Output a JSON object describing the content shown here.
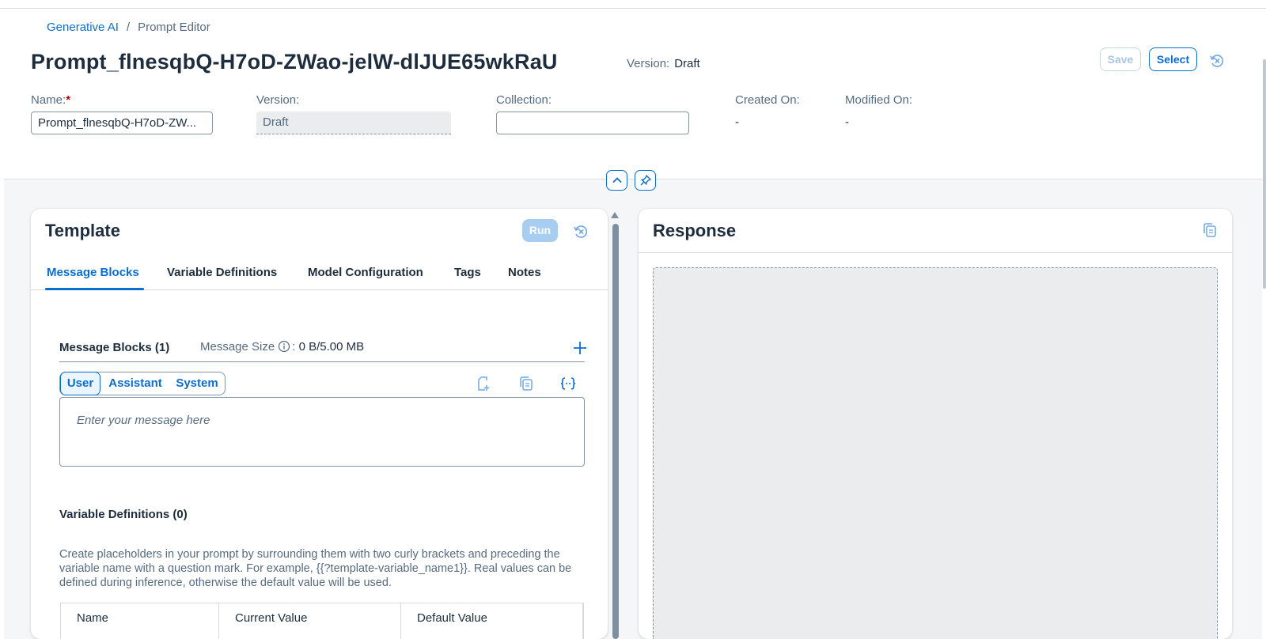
{
  "breadcrumb": {
    "parent": "Generative AI",
    "separator": "/",
    "current": "Prompt Editor"
  },
  "header": {
    "title": "Prompt_flnesqbQ-H7oD-ZWao-jelW-dlJUE65wkRaU",
    "version_label": "Version:",
    "version_value": "Draft",
    "save_label": "Save",
    "select_label": "Select"
  },
  "fields": {
    "name_label": "Name:",
    "name_required": "*",
    "name_value": "Prompt_flnesqbQ-H7oD-ZW...",
    "version_label": "Version:",
    "version_value": "Draft",
    "collection_label": "Collection:",
    "collection_value": "",
    "created_label": "Created On:",
    "created_value": "-",
    "modified_label": "Modified On:",
    "modified_value": "-"
  },
  "template": {
    "title": "Template",
    "run_label": "Run",
    "tabs": [
      "Message Blocks",
      "Variable Definitions",
      "Model Configuration",
      "Tags",
      "Notes"
    ],
    "active_tab": "Message Blocks",
    "message_blocks_title": "Message Blocks (1)",
    "message_size_label": "Message Size",
    "message_size_sep": ":",
    "message_size_value": "0 B/5.00 MB",
    "roles": [
      "User",
      "Assistant",
      "System"
    ],
    "selected_role": "User",
    "message_placeholder": "Enter your message here",
    "variable_definitions_title": "Variable Definitions (0)",
    "variable_definitions_desc": "Create placeholders in your prompt by surrounding them with two curly brackets and preceding the variable name with a question mark. For example, {{?template-variable_name1}}. Real values can be defined during inference, otherwise the default value will be used.",
    "table_headers": [
      "Name",
      "Current Value",
      "Default Value"
    ]
  },
  "response": {
    "title": "Response"
  },
  "colors": {
    "accent": "#0a6ed1",
    "text": "#1d2d3e",
    "muted": "#556b82",
    "required": "#aa0808"
  },
  "icons": [
    "cancel-icon",
    "chevron-up-icon",
    "pin-icon",
    "info-icon",
    "add-icon",
    "add-file-icon",
    "copy-icon",
    "variable-braces-icon"
  ]
}
